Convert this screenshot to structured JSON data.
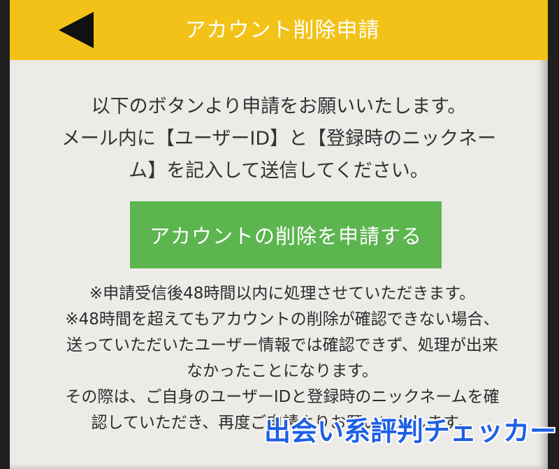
{
  "header": {
    "title": "アカウント削除申請",
    "back_icon": "back-arrow-icon",
    "background_color": "#f2c218"
  },
  "intro": {
    "lines": [
      "以下のボタンより申請をお願いいたします。",
      "メール内に【ユーザーID】と【登録時のニックネー",
      "ム】を記入して送信してください。"
    ]
  },
  "cta": {
    "label": "アカウントの削除を申請する",
    "color": "#5cb54f"
  },
  "notes": {
    "lines": [
      "※申請受信後48時間以内に処理させていただきます。",
      "※48時間を超えてもアカウントの削除が確認できない場合、",
      "送っていただいたユーザー情報では確認できず、処理が出来",
      "なかったことになります。",
      "その際は、ご自身のユーザーIDと登録時のニックネームを確",
      "認していただき、再度ご申請よりお願いいたします。"
    ]
  },
  "watermark": {
    "text": "出会い系評判チェッカー"
  }
}
